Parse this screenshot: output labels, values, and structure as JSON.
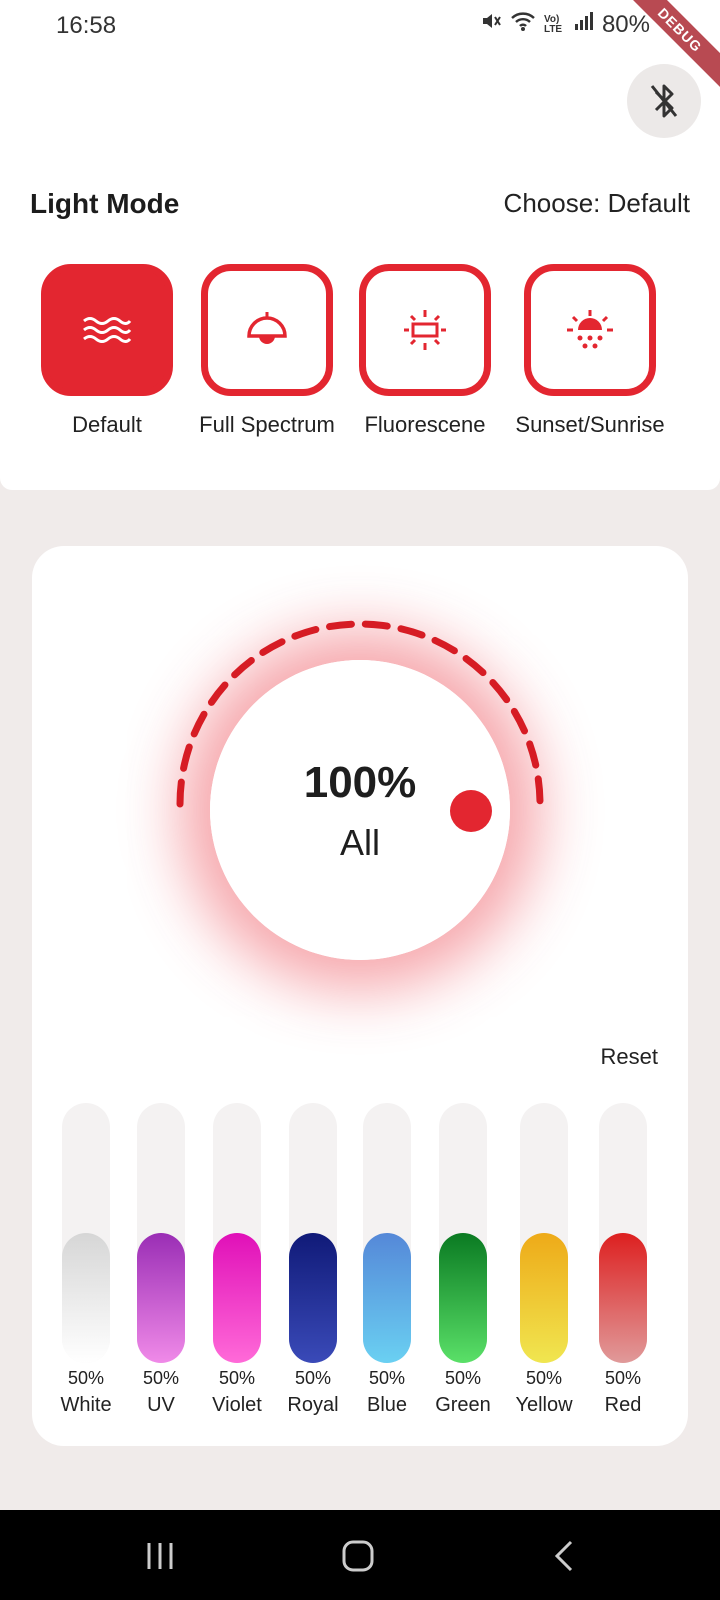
{
  "status_bar": {
    "time": "16:58",
    "battery": "80%",
    "icons": [
      "mute-icon",
      "wifi-icon",
      "volte-icon",
      "signal-icon",
      "battery-icon"
    ],
    "volte": "Vo) LTE",
    "debug": "DEBUG"
  },
  "header": {
    "bluetooth_icon": "bluetooth-disabled-icon"
  },
  "light_mode": {
    "title": "Light Mode",
    "choose": "Choose: Default",
    "modes": [
      {
        "label": "Default",
        "icon": "waves-icon",
        "active": true
      },
      {
        "label": "Full Spectrum",
        "icon": "lamp-icon",
        "active": false
      },
      {
        "label": "Fluorescene",
        "icon": "fluorescent-icon",
        "active": false
      },
      {
        "label": "Sunset/Sunrise",
        "icon": "sunrise-icon",
        "active": false
      }
    ]
  },
  "dial": {
    "percent": "100%",
    "label": "All",
    "level": 1.0
  },
  "reset": "Reset",
  "channels": [
    {
      "name": "White",
      "percent": "50%",
      "level": 0.5,
      "top": "#d6d6d6",
      "bottom": "#ffffff"
    },
    {
      "name": "UV",
      "percent": "50%",
      "level": 0.5,
      "top": "#9a2eb5",
      "bottom": "#f08ae8"
    },
    {
      "name": "Violet",
      "percent": "50%",
      "level": 0.5,
      "top": "#e010b8",
      "bottom": "#ff6ad8"
    },
    {
      "name": "Royal",
      "percent": "50%",
      "level": 0.5,
      "top": "#101a78",
      "bottom": "#3a4ab8"
    },
    {
      "name": "Blue",
      "percent": "50%",
      "level": 0.5,
      "top": "#5588d8",
      "bottom": "#6ad0f2"
    },
    {
      "name": "Green",
      "percent": "50%",
      "level": 0.5,
      "top": "#0a7a22",
      "bottom": "#5ae068"
    },
    {
      "name": "Yellow",
      "percent": "50%",
      "level": 0.5,
      "top": "#eeaa18",
      "bottom": "#f0e650"
    },
    {
      "name": "Red",
      "percent": "50%",
      "level": 0.5,
      "top": "#dd2020",
      "bottom": "#e09a9a"
    }
  ],
  "colors": {
    "accent": "#e32630",
    "card": "#ffffff",
    "background": "#f0ebea"
  },
  "nav": {
    "icons": [
      "recent-apps-icon",
      "home-icon",
      "back-icon"
    ]
  }
}
